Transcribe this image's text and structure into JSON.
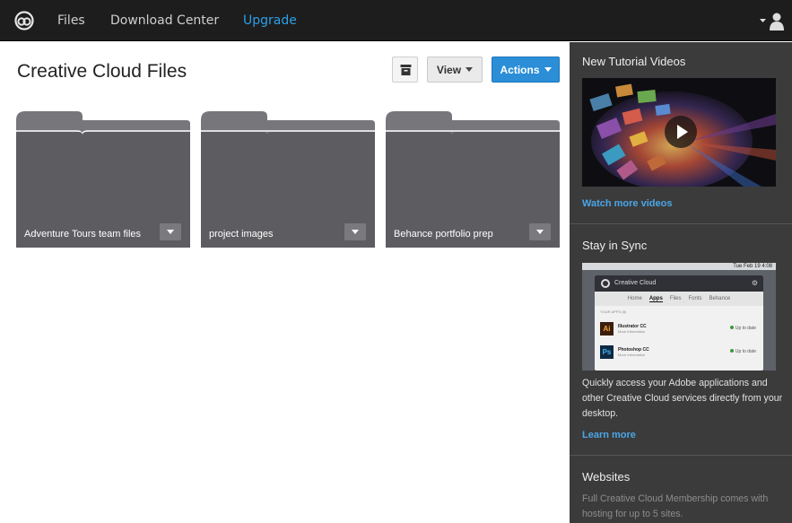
{
  "nav": {
    "logo": "creative-cloud-logo",
    "files": "Files",
    "download_center": "Download Center",
    "upgrade": "Upgrade",
    "accent": "#2d9fe8"
  },
  "main": {
    "title": "Creative Cloud Files",
    "view_label": "View",
    "actions_label": "Actions",
    "actions_color": "#2b8ed7",
    "folders": [
      {
        "name": "Adventure Tours team files"
      },
      {
        "name": "project images"
      },
      {
        "name": "Behance portfolio prep"
      }
    ]
  },
  "sidebar": {
    "tutorials": {
      "title": "New Tutorial Videos",
      "link": "Watch more videos"
    },
    "sync": {
      "title": "Stay in Sync",
      "screenshot": {
        "clock": "Tue Feb 19  4:08",
        "app_title": "Creative Cloud",
        "tabs": [
          "Home",
          "Apps",
          "Files",
          "Fonts",
          "Behance"
        ],
        "active_tab": "Apps",
        "section": "YOUR APPS (8)",
        "apps": [
          {
            "icon": "Ai",
            "name": "Illustrator CC",
            "sub": "More Information",
            "status": "Up to date"
          },
          {
            "icon": "Ps",
            "name": "Photoshop CC",
            "sub": "More Information",
            "status": "Up to date"
          }
        ]
      },
      "text": "Quickly access your Adobe applications and other Creative Cloud services directly from your desktop.",
      "link": "Learn more"
    },
    "websites": {
      "title": "Websites",
      "text": "Full Creative Cloud Membership comes with hosting for up to 5 sites."
    }
  }
}
